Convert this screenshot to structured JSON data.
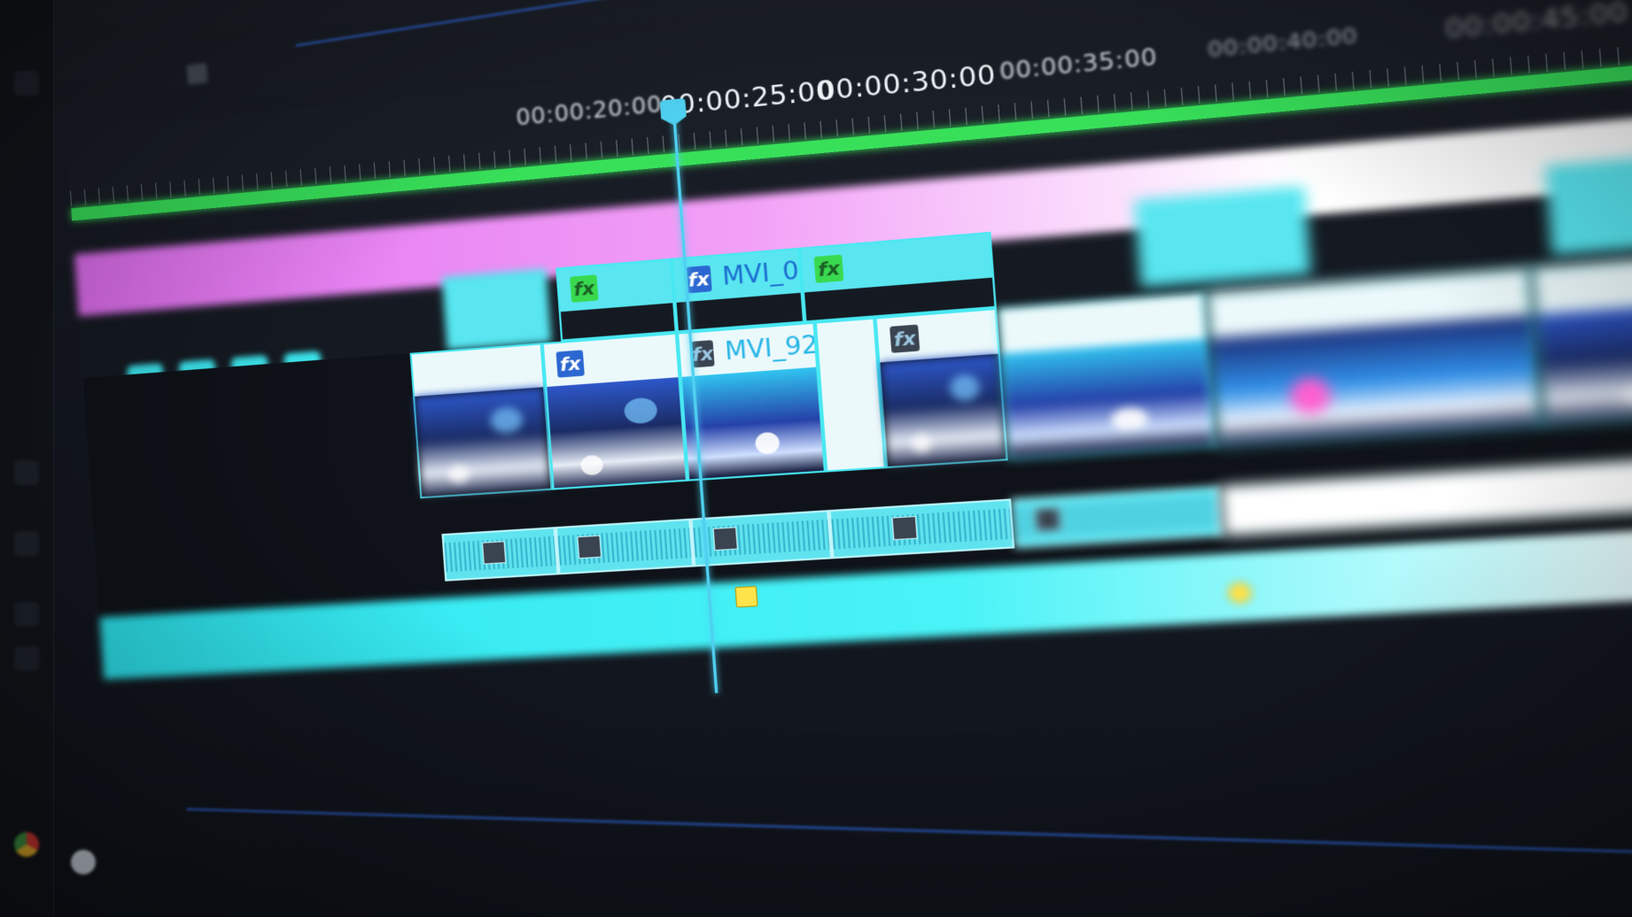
{
  "ruler": {
    "labels": [
      "00:00:20:00",
      "00:00:25:00",
      "00:00:30:00",
      "00:00:35:00",
      "00:00:40:00",
      "00:00:45:00"
    ]
  },
  "clips": {
    "v2_mvi0": {
      "label": "MVI_0",
      "fx": "fx"
    },
    "v2_next": {
      "label": "",
      "fx": "fx"
    },
    "v1_mvi92": {
      "label": "MVI_92",
      "fx": "fx"
    }
  },
  "colors": {
    "accent_cyan": "#48e8f2",
    "workarea_green": "#38e05a",
    "track_magenta": "#e06ef0",
    "keyframe_yellow": "#ffe34a"
  }
}
